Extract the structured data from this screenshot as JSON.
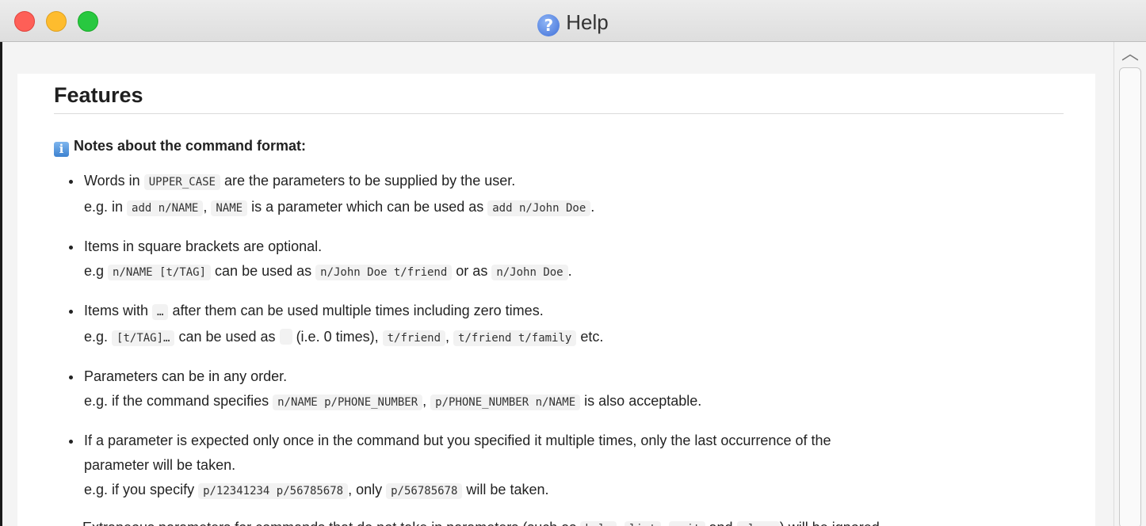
{
  "window": {
    "title": "Help"
  },
  "page": {
    "heading": "Features",
    "notes_heading": "Notes about the command format:",
    "items": [
      {
        "line1": [
          "Words in ",
          {
            "code": "UPPER_CASE"
          },
          " are the parameters to be supplied by the user."
        ],
        "line2": [
          "e.g. in ",
          {
            "code": "add n/NAME"
          },
          ", ",
          {
            "code": "NAME"
          },
          " is a parameter which can be used as ",
          {
            "code": "add n/John Doe"
          },
          "."
        ]
      },
      {
        "line1": [
          "Items in square brackets are optional."
        ],
        "line2": [
          "e.g ",
          {
            "code": "n/NAME [t/TAG]"
          },
          " can be used as ",
          {
            "code": "n/John Doe t/friend"
          },
          " or as ",
          {
            "code": "n/John Doe"
          },
          "."
        ]
      },
      {
        "line1": [
          "Items with ",
          {
            "code": "…"
          },
          " after them can be used multiple times including zero times."
        ],
        "line2": [
          "e.g. ",
          {
            "code": "[t/TAG]…"
          },
          " can be used as ",
          {
            "code": ""
          },
          " (i.e. 0 times), ",
          {
            "code": "t/friend"
          },
          ", ",
          {
            "code": "t/friend t/family"
          },
          " etc."
        ]
      },
      {
        "line1": [
          "Parameters can be in any order."
        ],
        "line2": [
          "e.g. if the command specifies ",
          {
            "code": "n/NAME p/PHONE_NUMBER"
          },
          ", ",
          {
            "code": "p/PHONE_NUMBER n/NAME"
          },
          " is also acceptable."
        ]
      },
      {
        "line1": [
          "If a parameter is expected only once in the command but you specified it multiple times, only the last occurrence of the"
        ],
        "line1b": [
          "parameter will be taken."
        ],
        "line2": [
          "e.g. if you specify ",
          {
            "code": "p/12341234 p/56785678"
          },
          ", only ",
          {
            "code": "p/56785678"
          },
          " will be taken."
        ]
      }
    ],
    "cut_paragraph": [
      "Extraneous parameters for commands that do not take in parameters (such as ",
      {
        "code": "help"
      },
      ", ",
      {
        "code": "list"
      },
      ", ",
      {
        "code": "exit"
      },
      " and ",
      {
        "code": "clear"
      },
      ") will be ignored."
    ]
  },
  "icons": {
    "help": "question-mark-circle-icon",
    "info": "info-icon",
    "scroll_up": "chevron-up-icon"
  }
}
